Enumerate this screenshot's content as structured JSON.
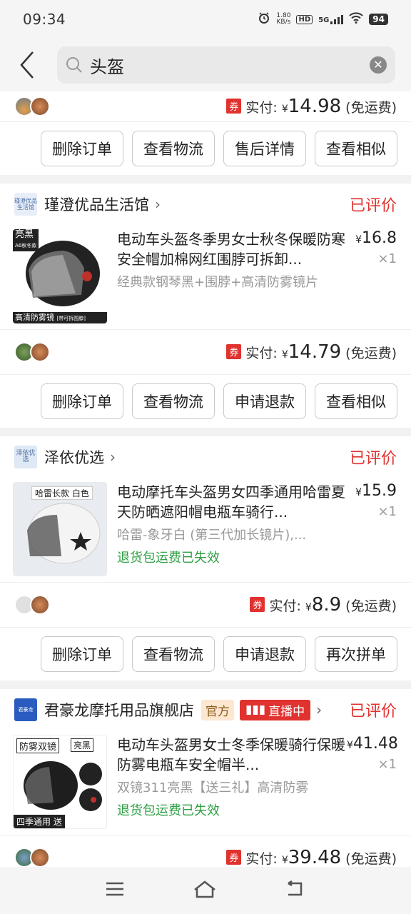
{
  "status_bar": {
    "time": "09:34",
    "net_speed_value": "1.80",
    "net_speed_unit": "KB/s",
    "hd": "HD",
    "network": "5G",
    "battery": "94"
  },
  "search": {
    "query": "头盔"
  },
  "partial_order_top": {
    "pay_label": "实付:",
    "currency": "¥",
    "amount": "14.98",
    "shipping": "(免运费)"
  },
  "order_buttons_1": [
    "删除订单",
    "查看物流",
    "售后详情",
    "查看相似"
  ],
  "orders": [
    {
      "shop_name": "瑾澄优品生活馆",
      "shop_logo_text": "瑾澄优品生活馆",
      "status": "已评价",
      "product_title": "电动车头盔冬季男女士秋冬保暖防寒安全帽加棉网红围脖可拆卸...",
      "sku": "经典款钢琴黑+围脖+高清防雾镜片",
      "price": "16.8",
      "qty": "×1",
      "thumb_tag_top": "亮黑",
      "thumb_tag_sub": "A6秋冬款",
      "thumb_tag_bottom": "高清防雾镜",
      "thumb_tag_bottom2": "[带可拆围脖]",
      "pay_amount": "14.79",
      "buttons": [
        "删除订单",
        "查看物流",
        "申请退款",
        "查看相似"
      ]
    },
    {
      "shop_name": "泽依优选",
      "shop_logo_text": "泽依优选",
      "status": "已评价",
      "product_title": "电动摩托车头盔男女四季通用哈雷夏天防晒遮阳帽电瓶车骑行...",
      "sku": "哈雷-象牙白 (第三代加长镜片),...",
      "return_note": "退货包运费已失效",
      "price": "15.9",
      "qty": "×1",
      "thumb_tag_top": "哈雷长款 白色",
      "pay_amount": "8.9",
      "buttons": [
        "删除订单",
        "查看物流",
        "申请退款",
        "再次拼单"
      ]
    },
    {
      "shop_name": "君豪龙摩托用品旗舰店",
      "shop_logo_text": "君豪龙",
      "official_tag": "官方",
      "live_tag": "直播中",
      "status": "已评价",
      "product_title": "电动车头盔男女士冬季保暖骑行保暖防雾电瓶车安全帽半...",
      "sku": "双镜311亮黑【送三礼】高清防雾",
      "return_note": "退货包运费已失效",
      "price": "41.48",
      "qty": "×1",
      "thumb_tag_top": "防雾双镜",
      "thumb_tag_top2": "亮黑",
      "thumb_tag_bottom": "四季通用",
      "thumb_tag_bottom2": "送",
      "pay_amount": "39.48"
    }
  ],
  "common": {
    "pay_label": "实付:",
    "currency": "¥",
    "shipping": "(免运费)",
    "coupon": "券"
  },
  "colors": {
    "accent_red": "#e0322f",
    "green": "#2ea043"
  }
}
